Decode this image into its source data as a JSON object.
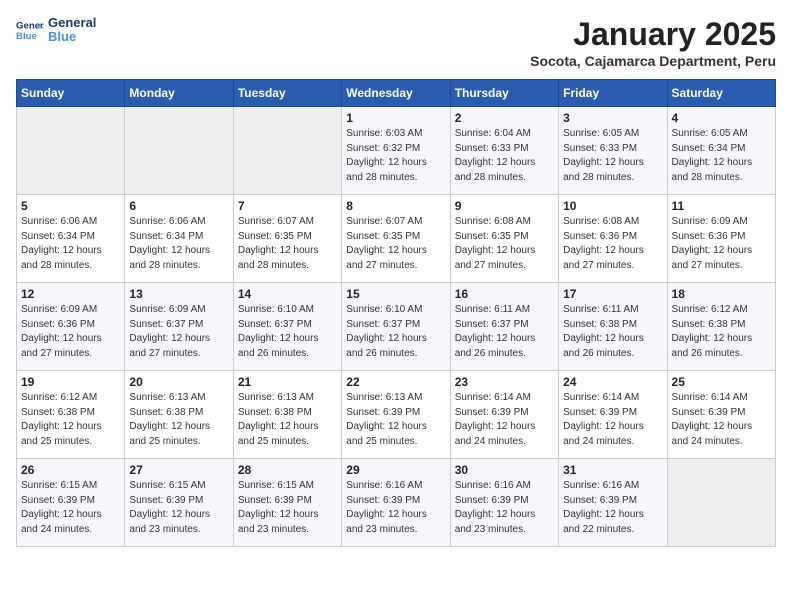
{
  "header": {
    "logo_line1": "General",
    "logo_line2": "Blue",
    "month_title": "January 2025",
    "location": "Socota, Cajamarca Department, Peru"
  },
  "days_of_week": [
    "Sunday",
    "Monday",
    "Tuesday",
    "Wednesday",
    "Thursday",
    "Friday",
    "Saturday"
  ],
  "weeks": [
    [
      {
        "num": "",
        "info": ""
      },
      {
        "num": "",
        "info": ""
      },
      {
        "num": "",
        "info": ""
      },
      {
        "num": "1",
        "info": "Sunrise: 6:03 AM\nSunset: 6:32 PM\nDaylight: 12 hours\nand 28 minutes."
      },
      {
        "num": "2",
        "info": "Sunrise: 6:04 AM\nSunset: 6:33 PM\nDaylight: 12 hours\nand 28 minutes."
      },
      {
        "num": "3",
        "info": "Sunrise: 6:05 AM\nSunset: 6:33 PM\nDaylight: 12 hours\nand 28 minutes."
      },
      {
        "num": "4",
        "info": "Sunrise: 6:05 AM\nSunset: 6:34 PM\nDaylight: 12 hours\nand 28 minutes."
      }
    ],
    [
      {
        "num": "5",
        "info": "Sunrise: 6:06 AM\nSunset: 6:34 PM\nDaylight: 12 hours\nand 28 minutes."
      },
      {
        "num": "6",
        "info": "Sunrise: 6:06 AM\nSunset: 6:34 PM\nDaylight: 12 hours\nand 28 minutes."
      },
      {
        "num": "7",
        "info": "Sunrise: 6:07 AM\nSunset: 6:35 PM\nDaylight: 12 hours\nand 28 minutes."
      },
      {
        "num": "8",
        "info": "Sunrise: 6:07 AM\nSunset: 6:35 PM\nDaylight: 12 hours\nand 27 minutes."
      },
      {
        "num": "9",
        "info": "Sunrise: 6:08 AM\nSunset: 6:35 PM\nDaylight: 12 hours\nand 27 minutes."
      },
      {
        "num": "10",
        "info": "Sunrise: 6:08 AM\nSunset: 6:36 PM\nDaylight: 12 hours\nand 27 minutes."
      },
      {
        "num": "11",
        "info": "Sunrise: 6:09 AM\nSunset: 6:36 PM\nDaylight: 12 hours\nand 27 minutes."
      }
    ],
    [
      {
        "num": "12",
        "info": "Sunrise: 6:09 AM\nSunset: 6:36 PM\nDaylight: 12 hours\nand 27 minutes."
      },
      {
        "num": "13",
        "info": "Sunrise: 6:09 AM\nSunset: 6:37 PM\nDaylight: 12 hours\nand 27 minutes."
      },
      {
        "num": "14",
        "info": "Sunrise: 6:10 AM\nSunset: 6:37 PM\nDaylight: 12 hours\nand 26 minutes."
      },
      {
        "num": "15",
        "info": "Sunrise: 6:10 AM\nSunset: 6:37 PM\nDaylight: 12 hours\nand 26 minutes."
      },
      {
        "num": "16",
        "info": "Sunrise: 6:11 AM\nSunset: 6:37 PM\nDaylight: 12 hours\nand 26 minutes."
      },
      {
        "num": "17",
        "info": "Sunrise: 6:11 AM\nSunset: 6:38 PM\nDaylight: 12 hours\nand 26 minutes."
      },
      {
        "num": "18",
        "info": "Sunrise: 6:12 AM\nSunset: 6:38 PM\nDaylight: 12 hours\nand 26 minutes."
      }
    ],
    [
      {
        "num": "19",
        "info": "Sunrise: 6:12 AM\nSunset: 6:38 PM\nDaylight: 12 hours\nand 25 minutes."
      },
      {
        "num": "20",
        "info": "Sunrise: 6:13 AM\nSunset: 6:38 PM\nDaylight: 12 hours\nand 25 minutes."
      },
      {
        "num": "21",
        "info": "Sunrise: 6:13 AM\nSunset: 6:38 PM\nDaylight: 12 hours\nand 25 minutes."
      },
      {
        "num": "22",
        "info": "Sunrise: 6:13 AM\nSunset: 6:39 PM\nDaylight: 12 hours\nand 25 minutes."
      },
      {
        "num": "23",
        "info": "Sunrise: 6:14 AM\nSunset: 6:39 PM\nDaylight: 12 hours\nand 24 minutes."
      },
      {
        "num": "24",
        "info": "Sunrise: 6:14 AM\nSunset: 6:39 PM\nDaylight: 12 hours\nand 24 minutes."
      },
      {
        "num": "25",
        "info": "Sunrise: 6:14 AM\nSunset: 6:39 PM\nDaylight: 12 hours\nand 24 minutes."
      }
    ],
    [
      {
        "num": "26",
        "info": "Sunrise: 6:15 AM\nSunset: 6:39 PM\nDaylight: 12 hours\nand 24 minutes."
      },
      {
        "num": "27",
        "info": "Sunrise: 6:15 AM\nSunset: 6:39 PM\nDaylight: 12 hours\nand 23 minutes."
      },
      {
        "num": "28",
        "info": "Sunrise: 6:15 AM\nSunset: 6:39 PM\nDaylight: 12 hours\nand 23 minutes."
      },
      {
        "num": "29",
        "info": "Sunrise: 6:16 AM\nSunset: 6:39 PM\nDaylight: 12 hours\nand 23 minutes."
      },
      {
        "num": "30",
        "info": "Sunrise: 6:16 AM\nSunset: 6:39 PM\nDaylight: 12 hours\nand 23 minutes."
      },
      {
        "num": "31",
        "info": "Sunrise: 6:16 AM\nSunset: 6:39 PM\nDaylight: 12 hours\nand 22 minutes."
      },
      {
        "num": "",
        "info": ""
      }
    ]
  ]
}
